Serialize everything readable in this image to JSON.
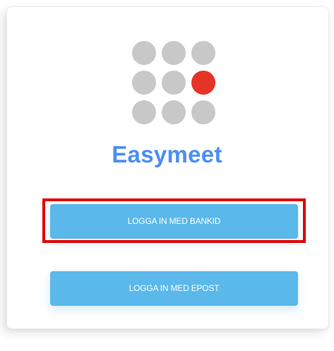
{
  "app": {
    "name": "Easymeet"
  },
  "colors": {
    "brand": "#4c8ef7",
    "button": "#5ab8ea",
    "dot": "#c8c8c8",
    "dot_active": "#e53327",
    "highlight": "#e00000"
  },
  "logo": {
    "icon": "dot-grid-logo",
    "rows": 3,
    "cols": 3,
    "active_dot": "row 2, col 3"
  },
  "buttons": {
    "bankid_label": "LOGGA IN MED BANKID",
    "epost_label": "LOGGA IN MED EPOST"
  }
}
